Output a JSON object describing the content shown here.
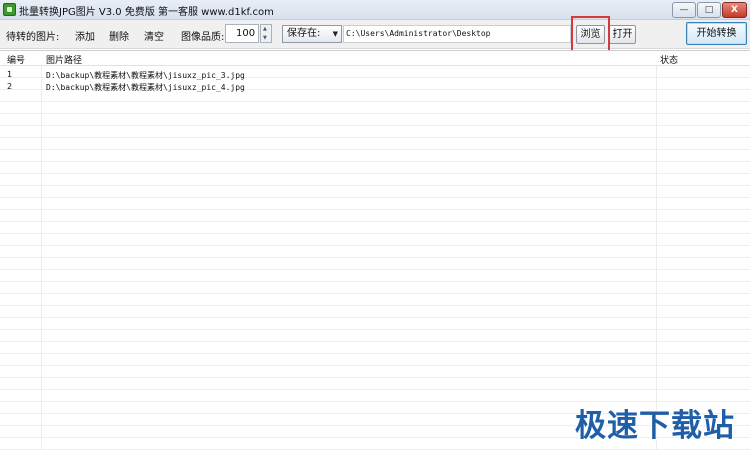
{
  "window": {
    "title": "批量转换JPG图片 V3.0 免费版   第一客服 www.d1kf.com",
    "min_label": "—",
    "max_label": "□",
    "close_label": "X"
  },
  "toolbar": {
    "pending_label": "待转的图片:",
    "add_label": "添加",
    "delete_label": "删除",
    "clear_label": "清空",
    "quality_label": "图像品质:",
    "quality_value": "100",
    "save_to_label": "保存在:",
    "save_path": "C:\\Users\\Administrator\\Desktop",
    "browse_label": "浏览",
    "open_label": "打开",
    "start_label": "开始转换"
  },
  "table": {
    "headers": {
      "no": "编号",
      "path": "图片路径",
      "status": "状态"
    },
    "rows": [
      {
        "no": "1",
        "path": "D:\\backup\\教程素材\\教程素材\\jisuxz_pic_3.jpg",
        "status": ""
      },
      {
        "no": "2",
        "path": "D:\\backup\\教程素材\\教程素材\\jisuxz_pic_4.jpg",
        "status": ""
      }
    ]
  },
  "watermark": "极速下载站",
  "colors": {
    "highlight": "#d43a3a",
    "watermark": "#1f5fa8"
  }
}
